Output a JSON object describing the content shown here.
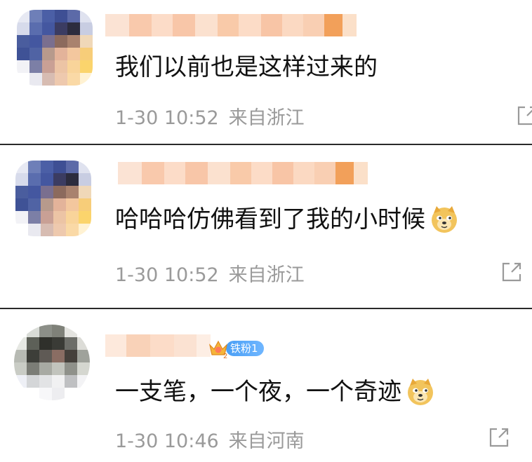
{
  "comments": [
    {
      "text": "我们以前也是这样过来的",
      "time": "1-30 10:52",
      "location": "来自浙江",
      "share_icon": "share-icon"
    },
    {
      "text": "哈哈哈仿佛看到了我的小时候",
      "time": "1-30 10:52",
      "location": "来自浙江",
      "emoji": "doge-emoji",
      "share_icon": "share-icon"
    },
    {
      "text": "一支笔，一个夜，一个奇迹",
      "time": "1-30 10:46",
      "location": "来自河南",
      "emoji": "doge-emoji",
      "badge": "铁粉1",
      "share_icon": "share-icon"
    }
  ],
  "colors": {
    "divider": "#2a2a2a",
    "meta_text": "#9a9a9a",
    "name_blur_light": "#fbd5bf",
    "name_blur_accent": "#f39a3f",
    "badge_blue": "#4a9ff5"
  }
}
